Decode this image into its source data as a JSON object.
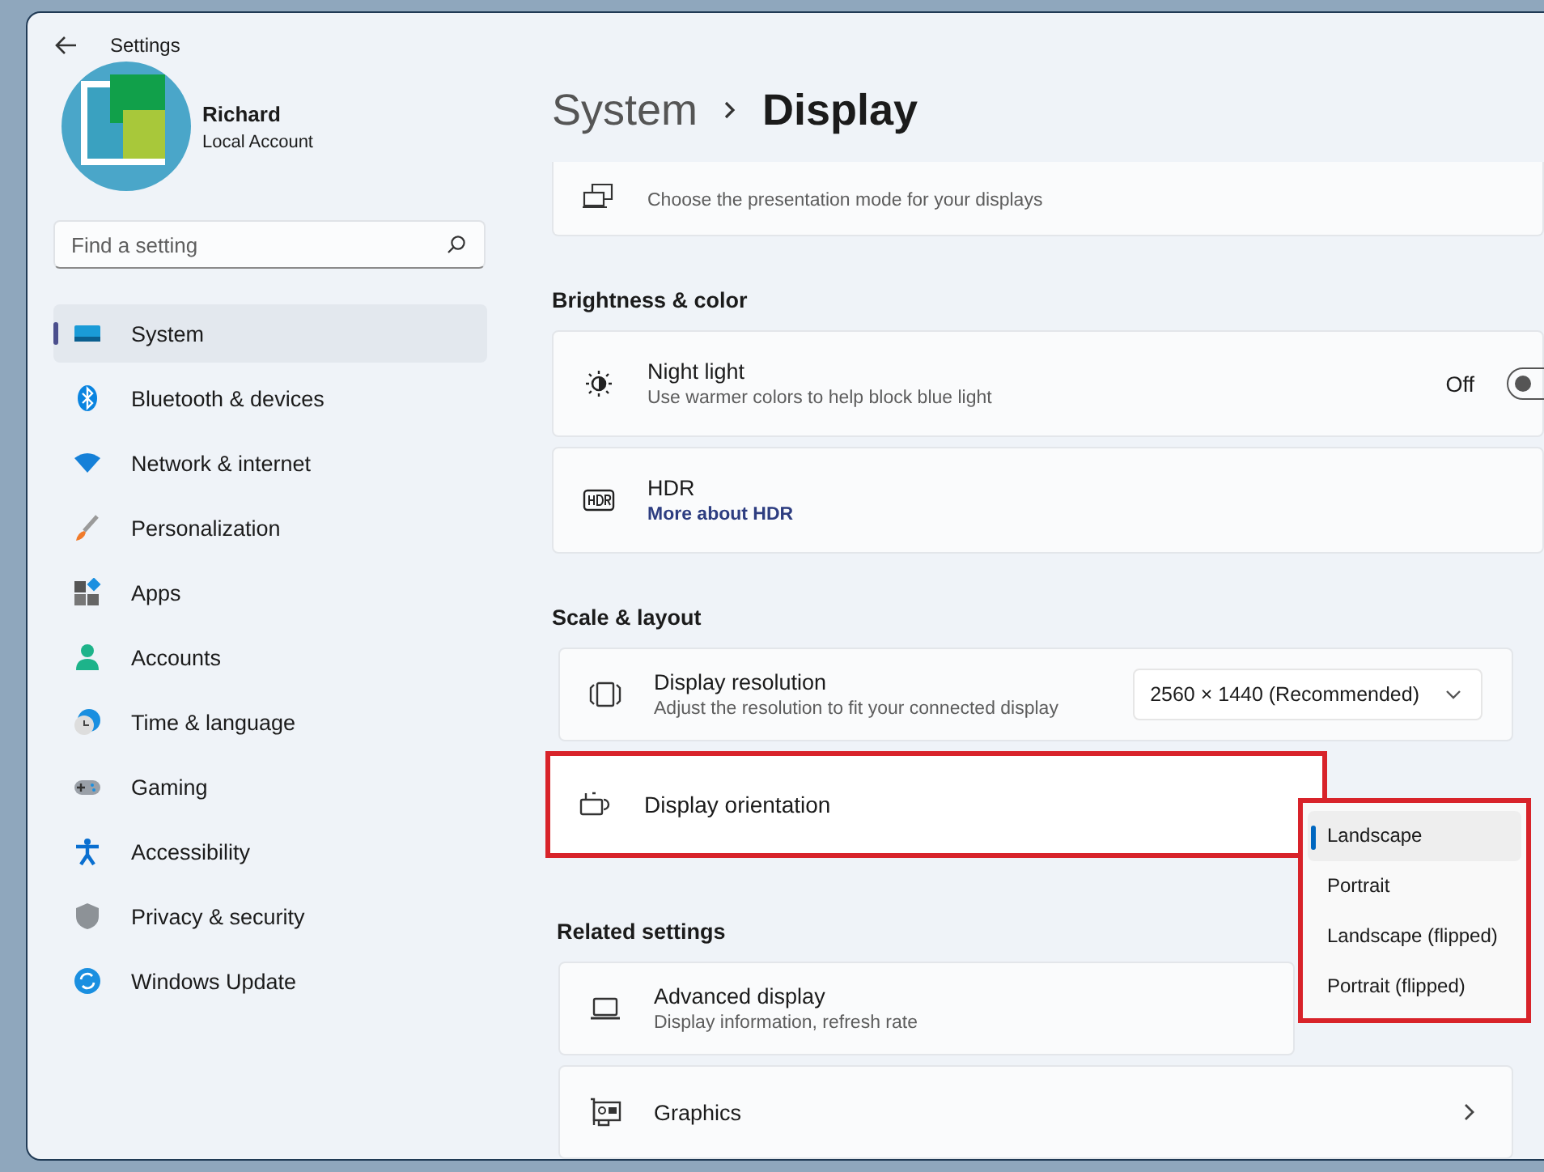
{
  "window": {
    "title": "Settings"
  },
  "account": {
    "name": "Richard",
    "type": "Local Account"
  },
  "search": {
    "placeholder": "Find a setting"
  },
  "sidebar": {
    "items": [
      {
        "label": "System",
        "selected": true
      },
      {
        "label": "Bluetooth & devices",
        "selected": false
      },
      {
        "label": "Network & internet",
        "selected": false
      },
      {
        "label": "Personalization",
        "selected": false
      },
      {
        "label": "Apps",
        "selected": false
      },
      {
        "label": "Accounts",
        "selected": false
      },
      {
        "label": "Time & language",
        "selected": false
      },
      {
        "label": "Gaming",
        "selected": false
      },
      {
        "label": "Accessibility",
        "selected": false
      },
      {
        "label": "Privacy & security",
        "selected": false
      },
      {
        "label": "Windows Update",
        "selected": false
      }
    ]
  },
  "breadcrumb": {
    "parent": "System",
    "current": "Display"
  },
  "sections": [
    {
      "rows": [
        {
          "kind": "cut",
          "subtitle": "Choose the presentation mode for your displays"
        }
      ]
    },
    {
      "heading": "Brightness & color",
      "rows": [
        {
          "kind": "toggle",
          "title": "Night light",
          "subtitle": "Use warmer colors to help block blue light",
          "value": "Off",
          "on": false
        },
        {
          "kind": "link",
          "title": "HDR",
          "link": "More about HDR"
        }
      ]
    },
    {
      "heading": "Scale & layout",
      "rows": [
        {
          "kind": "dropdown",
          "title": "Display resolution",
          "subtitle": "Adjust the resolution to fit your connected display",
          "value": "2560 × 1440 (Recommended)"
        },
        {
          "kind": "orientation",
          "title": "Display orientation",
          "highlighted": true
        }
      ]
    },
    {
      "heading": "Related settings",
      "rows": [
        {
          "kind": "plain",
          "title": "Advanced display",
          "subtitle": "Display information, refresh rate"
        },
        {
          "kind": "chevron",
          "title": "Graphics"
        }
      ]
    }
  ],
  "orientation_menu": {
    "highlighted": true,
    "options": [
      {
        "label": "Landscape",
        "selected": true
      },
      {
        "label": "Portrait",
        "selected": false
      },
      {
        "label": "Landscape (flipped)",
        "selected": false
      },
      {
        "label": "Portrait (flipped)",
        "selected": false
      }
    ]
  }
}
